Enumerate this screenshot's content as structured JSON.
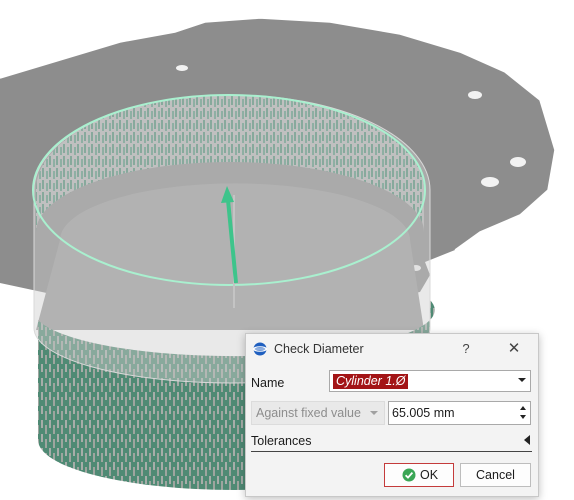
{
  "viewport": {
    "description_icon": "3d-mesh-view",
    "colors": {
      "surface_gray": "#8c8c8c",
      "texture_green": "#4f8a74",
      "arrow_green": "#3ec48b",
      "outline_mint": "#a9f0cf"
    }
  },
  "dialog": {
    "title": "Check Diameter",
    "help_label": "?",
    "close_label": "✕",
    "name_label": "Name",
    "name_value": "Cylinder 1.Ø",
    "mode_value": "Against fixed value",
    "diameter_value": "65.005 mm",
    "tolerances_label": "Tolerances",
    "ok_label": "OK",
    "cancel_label": "Cancel",
    "icons": {
      "app": "globe-icon",
      "ok": "check-circle-icon"
    },
    "colors": {
      "selection_bg": "#a31416",
      "ok_border": "#c43b3b",
      "ok_icon": "#3aa655"
    }
  }
}
